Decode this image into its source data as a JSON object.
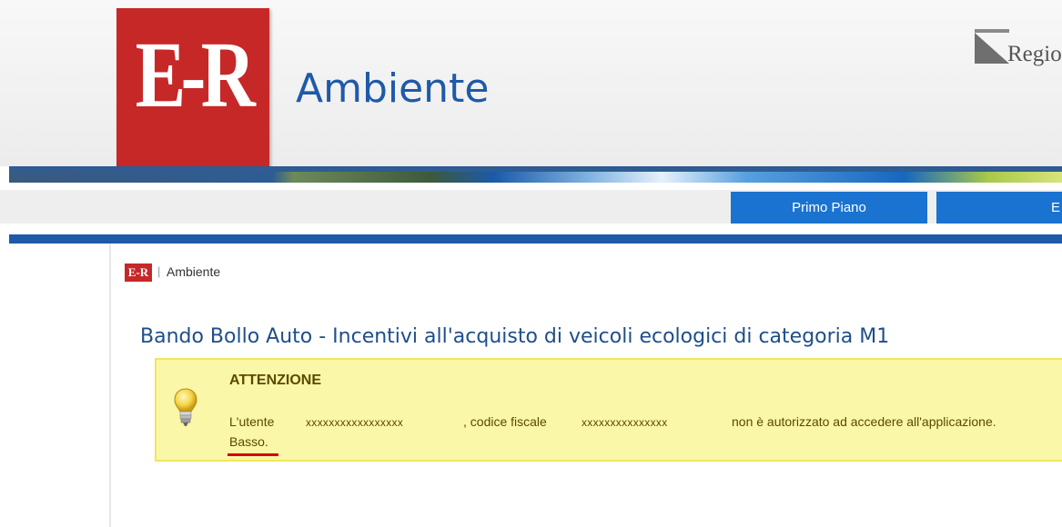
{
  "header": {
    "logo_text": "E-R",
    "site_title": "Ambiente",
    "regione_logo_text": "Regione"
  },
  "nav": {
    "items": [
      {
        "label": "Primo Piano"
      },
      {
        "label": "E"
      }
    ]
  },
  "breadcrumb": {
    "logo_text": "E-R",
    "separator": "|",
    "label": "Ambiente"
  },
  "page": {
    "title": "Bando Bollo Auto - Incentivi all'acquisto di veicoli ecologici di categoria M1"
  },
  "alert": {
    "icon": "lightbulb-icon",
    "title": "ATTENZIONE",
    "text_user": "L'utente",
    "user_value": "xxxxxxxxxxxxxxxxx",
    "text_codice": ", codice fiscale",
    "codice_value": "xxxxxxxxxxxxxxx",
    "text_not_authorized": "non è autorizzato ad accedere all'applicazione.",
    "text_level": "Basso."
  },
  "colors": {
    "brand_red": "#c62828",
    "brand_blue": "#1e5aa8",
    "nav_button": "#1a73d0",
    "alert_bg": "#fbf7a8",
    "alert_border": "#f1e65c",
    "highlight_red": "#d50000"
  }
}
